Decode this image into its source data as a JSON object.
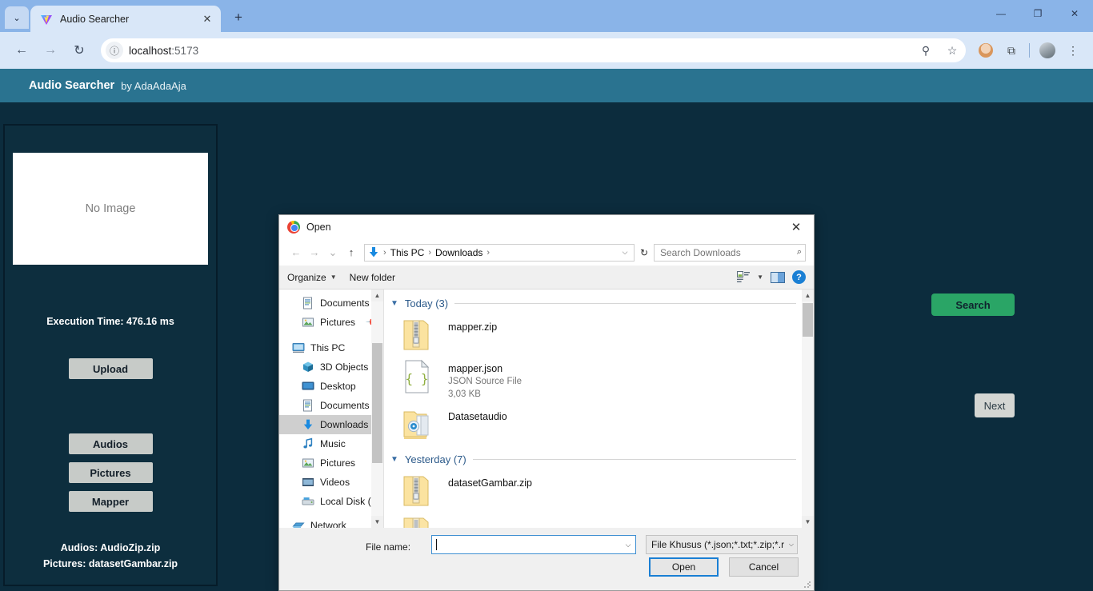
{
  "browser": {
    "tab": {
      "title": "Audio Searcher",
      "favicon": "vite-logo-icon",
      "close": "✕"
    },
    "new_tab": "+",
    "tab_list_caret": "⌄",
    "window_controls": {
      "minimize": "—",
      "restore": "❐",
      "close": "✕"
    },
    "nav": {
      "back": "←",
      "forward": "→",
      "reload": "↻"
    },
    "omnibox": {
      "host": "localhost",
      "port": ":5173",
      "info_icon": "ⓘ",
      "zoom_icon": "⚲",
      "bookmark_icon": "☆"
    },
    "toolbar_icons": {
      "extensions": "⧉",
      "menu": "⋮"
    }
  },
  "app": {
    "title": "Audio Searcher",
    "byline": "by AdaAdaAja",
    "image_placeholder": "No Image",
    "execution_time": "Execution Time: 476.16 ms",
    "upload_label": "Upload",
    "buttons": [
      {
        "label": "Audios"
      },
      {
        "label": "Pictures"
      },
      {
        "label": "Mapper"
      }
    ],
    "loaded_files": [
      "Audios: AudioZip.zip",
      "Pictures: datasetGambar.zip"
    ],
    "search_label": "Search",
    "next_label": "Next",
    "colors": {
      "header": "#2a7390",
      "body": "#0c2c3d",
      "search_green": "#2aa566",
      "button_gray": "#c7cbc8"
    }
  },
  "dialog": {
    "title": "Open",
    "app_icon": "chrome-icon",
    "close": "✕",
    "nav": {
      "back": "←",
      "forward": "→",
      "recent": "⌄",
      "up": "↑"
    },
    "breadcrumb": {
      "location_icon": "downloads-arrow-icon",
      "parts": [
        "This PC",
        "Downloads"
      ],
      "separator": "›",
      "caret": "⌵"
    },
    "refresh": "↻",
    "search": {
      "placeholder": "Search Downloads",
      "icon": "⌕"
    },
    "toolbar": {
      "organize": "Organize",
      "new_folder": "New folder",
      "caret": "▼",
      "view_icon": "view-options-icon",
      "pane_icon": "preview-pane-icon",
      "help": "?"
    },
    "nav_tree": [
      {
        "label": "Documents",
        "icon": "document-icon",
        "pinned": true,
        "level": "indent",
        "selected": false
      },
      {
        "label": "Pictures",
        "icon": "picture-icon",
        "pinned": true,
        "level": "indent",
        "selected": false
      },
      {
        "label": "This PC",
        "icon": "computer-icon",
        "pinned": false,
        "level": "root",
        "selected": false
      },
      {
        "label": "3D Objects",
        "icon": "cube-icon",
        "pinned": false,
        "level": "indent",
        "selected": false
      },
      {
        "label": "Desktop",
        "icon": "desktop-icon",
        "pinned": false,
        "level": "indent",
        "selected": false
      },
      {
        "label": "Documents",
        "icon": "document-icon",
        "pinned": false,
        "level": "indent",
        "selected": false
      },
      {
        "label": "Downloads",
        "icon": "download-icon",
        "pinned": false,
        "level": "indent",
        "selected": true
      },
      {
        "label": "Music",
        "icon": "music-note-icon",
        "pinned": false,
        "level": "indent",
        "selected": false
      },
      {
        "label": "Pictures",
        "icon": "picture-icon",
        "pinned": false,
        "level": "indent",
        "selected": false
      },
      {
        "label": "Videos",
        "icon": "video-icon",
        "pinned": false,
        "level": "indent",
        "selected": false
      },
      {
        "label": "Local Disk (C:)",
        "icon": "disk-icon",
        "pinned": false,
        "level": "indent",
        "selected": false
      },
      {
        "label": "Network",
        "icon": "network-icon",
        "pinned": false,
        "level": "root",
        "selected": false
      }
    ],
    "groups": [
      {
        "label": "Today (3)",
        "files": [
          {
            "name": "mapper.zip",
            "type": "",
            "size": "",
            "icon": "zip-icon"
          },
          {
            "name": "mapper.json",
            "type": "JSON Source File",
            "size": "3,03 KB",
            "icon": "json-icon"
          },
          {
            "name": "Datasetaudio",
            "type": "",
            "size": "",
            "icon": "audio-folder-icon"
          }
        ]
      },
      {
        "label": "Yesterday (7)",
        "files": [
          {
            "name": "datasetGambar.zip",
            "type": "",
            "size": "",
            "icon": "zip-icon"
          }
        ]
      }
    ],
    "footer": {
      "file_name_label": "File name:",
      "file_name_value": "",
      "filter": "File Khusus (*.json;*.txt;*.zip;*.r",
      "filter_caret": "⌵",
      "open_label": "Open",
      "cancel_label": "Cancel"
    }
  }
}
